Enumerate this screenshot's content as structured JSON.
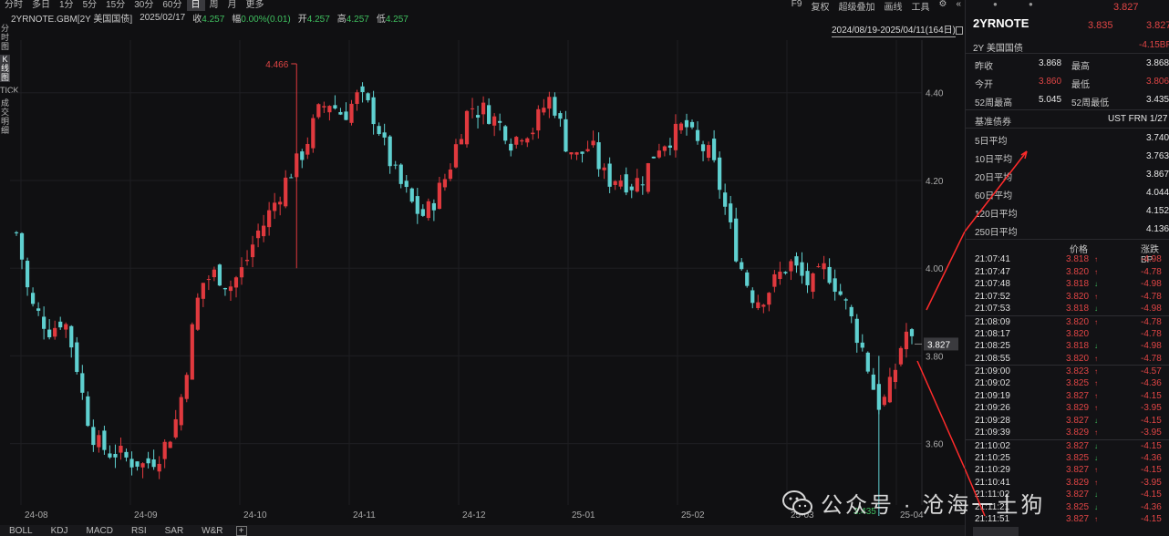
{
  "topbar": {
    "timeframes": [
      "分时",
      "多日",
      "1分",
      "5分",
      "15分",
      "30分",
      "60分",
      "日",
      "周",
      "月",
      "更多"
    ],
    "active_timeframe": "日",
    "right_items": [
      "F9",
      "复权",
      "超级叠加",
      "画线",
      "工具"
    ]
  },
  "infoline": {
    "symbol": "2YRNOTE.GBM[2Y 美国国债]",
    "date": "2025/02/17",
    "close_label": "收",
    "close": "4.257",
    "change_label": "幅",
    "change": "0.00%(0.01)",
    "open_label": "开",
    "open": "4.257",
    "high_label": "高",
    "high": "4.257",
    "low_label": "低",
    "low": "4.257"
  },
  "date_range": "2024/08/19-2025/04/11(164日)",
  "left_tabs": [
    "分时图",
    "K线图",
    "TICK",
    "成交明细"
  ],
  "bottom_indicators": [
    "BOLL",
    "KDJ",
    "MACD",
    "RSI",
    "SAR",
    "W&R"
  ],
  "chart_data": {
    "type": "candlestick",
    "x_tick_labels": [
      "24-08",
      "24-09",
      "24-10",
      "24-11",
      "24-12",
      "25-01",
      "25-02",
      "25-03",
      "25-04"
    ],
    "y_tick_labels": [
      "4.40",
      "4.20",
      "4.00",
      "3.80",
      "3.60"
    ],
    "ylim": [
      3.46,
      4.52
    ],
    "max_label": "4.466",
    "min_label": "3.435",
    "last_price": "3.827",
    "colors": {
      "up": "#e0393e",
      "down": "#5fd0d0"
    },
    "close_path": [
      4.08,
      4.01,
      3.92,
      3.9,
      3.88,
      3.86,
      3.87,
      3.89,
      3.84,
      3.78,
      3.7,
      3.64,
      3.6,
      3.59,
      3.58,
      3.58,
      3.57,
      3.56,
      3.56,
      3.55,
      3.56,
      3.57,
      3.59,
      3.62,
      3.66,
      3.73,
      3.83,
      3.92,
      3.97,
      3.98,
      3.99,
      3.97,
      3.96,
      3.98,
      4.0,
      4.04,
      4.08,
      4.1,
      4.13,
      4.16,
      4.19,
      4.22,
      4.24,
      4.27,
      4.31,
      4.35,
      4.37,
      4.38,
      4.36,
      4.35,
      4.37,
      4.39,
      4.38,
      4.36,
      4.33,
      4.28,
      4.24,
      4.2,
      4.18,
      4.15,
      4.13,
      4.12,
      4.14,
      4.17,
      4.2,
      4.24,
      4.29,
      4.34,
      4.37,
      4.36,
      4.36,
      4.35,
      4.33,
      4.32,
      4.29,
      4.3,
      4.32,
      4.31,
      4.34,
      4.37,
      4.39,
      4.35,
      4.29,
      4.27,
      4.25,
      4.27,
      4.28,
      4.24,
      4.21,
      4.2,
      4.21,
      4.2,
      4.19,
      4.2,
      4.21,
      4.25,
      4.28,
      4.29,
      4.3,
      4.31,
      4.33,
      4.3,
      4.28,
      4.27,
      4.25,
      4.2,
      4.14,
      4.08,
      4.02,
      3.98,
      3.94,
      3.93,
      3.94,
      3.96,
      3.98,
      4.0,
      4.01,
      3.99,
      3.97,
      3.96,
      3.98,
      4.0,
      3.98,
      3.95,
      3.92,
      3.88,
      3.84,
      3.8,
      3.74,
      3.69,
      3.7,
      3.74,
      3.8,
      3.86,
      3.83
    ],
    "candles_count": 164
  },
  "panel": {
    "top_price": "3.827",
    "code": "2YRNOTE",
    "price_a": "3.835",
    "price_b": "3.827",
    "name": "2Y 美国国债",
    "change_bp": "-4.15BP",
    "quotes": [
      {
        "l1": "昨收",
        "v1": "3.868",
        "c1": "white",
        "l2": "最高",
        "v2": "3.868",
        "c2": "white"
      },
      {
        "l1": "今开",
        "v1": "3.860",
        "c1": "red",
        "l2": "最低",
        "v2": "3.806",
        "c2": "red"
      },
      {
        "l1": "52周最高",
        "v1": "5.045",
        "c1": "white",
        "l2": "52周最低",
        "v2": "3.435",
        "c2": "white"
      }
    ],
    "benchmark_label": "基准债券",
    "benchmark_value": "UST FRN 1/27",
    "moving_averages": [
      {
        "label": "5日平均",
        "value": "3.740"
      },
      {
        "label": "10日平均",
        "value": "3.763"
      },
      {
        "label": "20日平均",
        "value": "3.867"
      },
      {
        "label": "60日平均",
        "value": "4.044"
      },
      {
        "label": "120日平均",
        "value": "4.152"
      },
      {
        "label": "250日平均",
        "value": "4.136"
      }
    ],
    "ticks_header": {
      "price": "价格",
      "change": "涨跌BP"
    },
    "ticks": [
      {
        "time": "21:07:41",
        "price": "3.818",
        "dir": "up",
        "chg": "-4.98"
      },
      {
        "time": "21:07:47",
        "price": "3.820",
        "dir": "up",
        "chg": "-4.78"
      },
      {
        "time": "21:07:48",
        "price": "3.818",
        "dir": "down",
        "chg": "-4.98"
      },
      {
        "time": "21:07:52",
        "price": "3.820",
        "dir": "up",
        "chg": "-4.78"
      },
      {
        "time": "21:07:53",
        "price": "3.818",
        "dir": "down",
        "chg": "-4.98"
      },
      {
        "time": "21:08:09",
        "price": "3.820",
        "dir": "up",
        "chg": "-4.78"
      },
      {
        "time": "21:08:17",
        "price": "3.820",
        "dir": "",
        "chg": "-4.78"
      },
      {
        "time": "21:08:25",
        "price": "3.818",
        "dir": "down",
        "chg": "-4.98"
      },
      {
        "time": "21:08:55",
        "price": "3.820",
        "dir": "up",
        "chg": "-4.78"
      },
      {
        "time": "21:09:00",
        "price": "3.823",
        "dir": "up",
        "chg": "-4.57"
      },
      {
        "time": "21:09:02",
        "price": "3.825",
        "dir": "up",
        "chg": "-4.36"
      },
      {
        "time": "21:09:19",
        "price": "3.827",
        "dir": "up",
        "chg": "-4.15"
      },
      {
        "time": "21:09:26",
        "price": "3.829",
        "dir": "up",
        "chg": "-3.95"
      },
      {
        "time": "21:09:28",
        "price": "3.827",
        "dir": "down",
        "chg": "-4.15"
      },
      {
        "time": "21:09:39",
        "price": "3.829",
        "dir": "up",
        "chg": "-3.95"
      },
      {
        "time": "21:10:02",
        "price": "3.827",
        "dir": "down",
        "chg": "-4.15"
      },
      {
        "time": "21:10:25",
        "price": "3.825",
        "dir": "down",
        "chg": "-4.36"
      },
      {
        "time": "21:10:29",
        "price": "3.827",
        "dir": "up",
        "chg": "-4.15"
      },
      {
        "time": "21:10:41",
        "price": "3.829",
        "dir": "up",
        "chg": "-3.95"
      },
      {
        "time": "21:11:02",
        "price": "3.827",
        "dir": "down",
        "chg": "-4.15"
      },
      {
        "time": "21:11:21",
        "price": "3.825",
        "dir": "down",
        "chg": "-4.36"
      },
      {
        "time": "21:11:51",
        "price": "3.827",
        "dir": "up",
        "chg": "-4.15"
      }
    ]
  },
  "watermark": "公众号 · 沧海一土狗",
  "colors": {
    "up": "#e0393e",
    "down": "#5fd0d0",
    "red_text": "#e04545",
    "green_text": "#3fbf5f",
    "bg": "#101012"
  }
}
